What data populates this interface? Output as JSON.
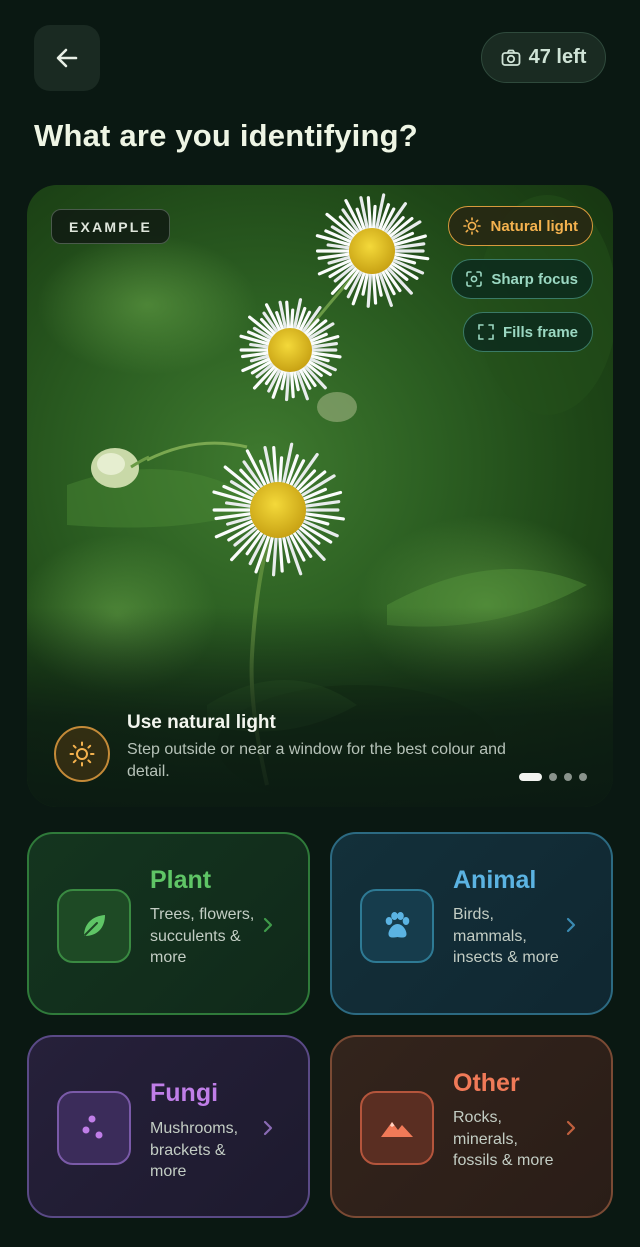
{
  "header": {
    "counter_label": "47 left",
    "title": "What are you identifying?"
  },
  "hero": {
    "badge": "EXAMPLE",
    "chips": [
      {
        "label": "Natural light",
        "icon": "sun-icon",
        "state": "active"
      },
      {
        "label": "Sharp focus",
        "icon": "focus-icon",
        "state": "inactive"
      },
      {
        "label": "Fills frame",
        "icon": "frame-icon",
        "state": "inactive"
      }
    ],
    "tip": {
      "icon": "sun-icon",
      "title": "Use natural light",
      "description": "Step outside or near a window for the best colour and detail."
    },
    "carousel": {
      "pages": 4,
      "current": 1
    }
  },
  "categories": [
    {
      "name": "Plant",
      "description": "Trees, flowers, succulents & more",
      "icon": "leaf-icon",
      "color": "#5fc566"
    },
    {
      "name": "Animal",
      "description": "Birds, mammals, insects & more",
      "icon": "paw-icon",
      "color": "#5bb3e2"
    },
    {
      "name": "Fungi",
      "description": "Mushrooms, brackets & more",
      "icon": "spores-icon",
      "color": "#c07ee8"
    },
    {
      "name": "Other",
      "description": "Rocks, minerals, fossils & more",
      "icon": "mountain-icon",
      "color": "#f07a58"
    }
  ],
  "colors": {
    "background": "#0a1812",
    "accent_warm": "#f4b24e",
    "accent_teal": "#9bd8c2"
  }
}
